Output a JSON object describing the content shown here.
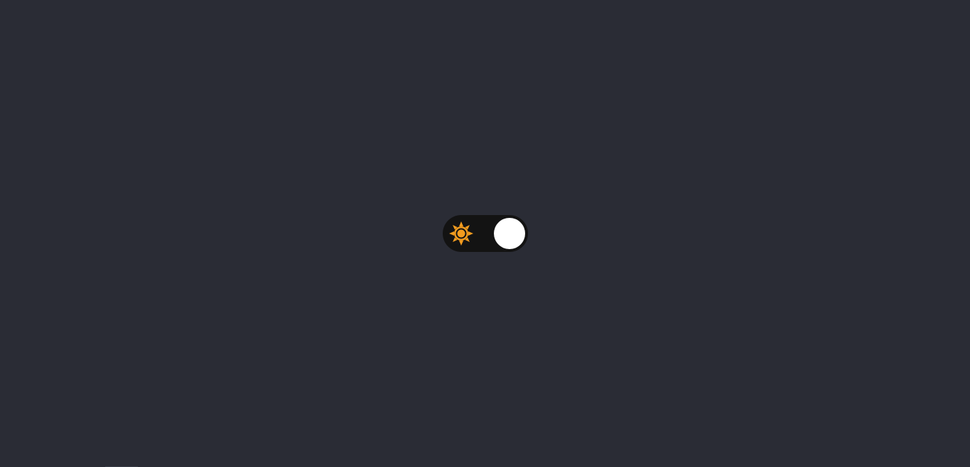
{
  "toggle": {
    "state": "light",
    "checked": false,
    "icons": {
      "left": "sun-icon",
      "right": "moon-icon"
    }
  },
  "colors": {
    "background": "#2a2c35",
    "track": "#131313",
    "knob": "#ffffff",
    "sun": "#f39c1f",
    "moon": "#f1c40f"
  }
}
